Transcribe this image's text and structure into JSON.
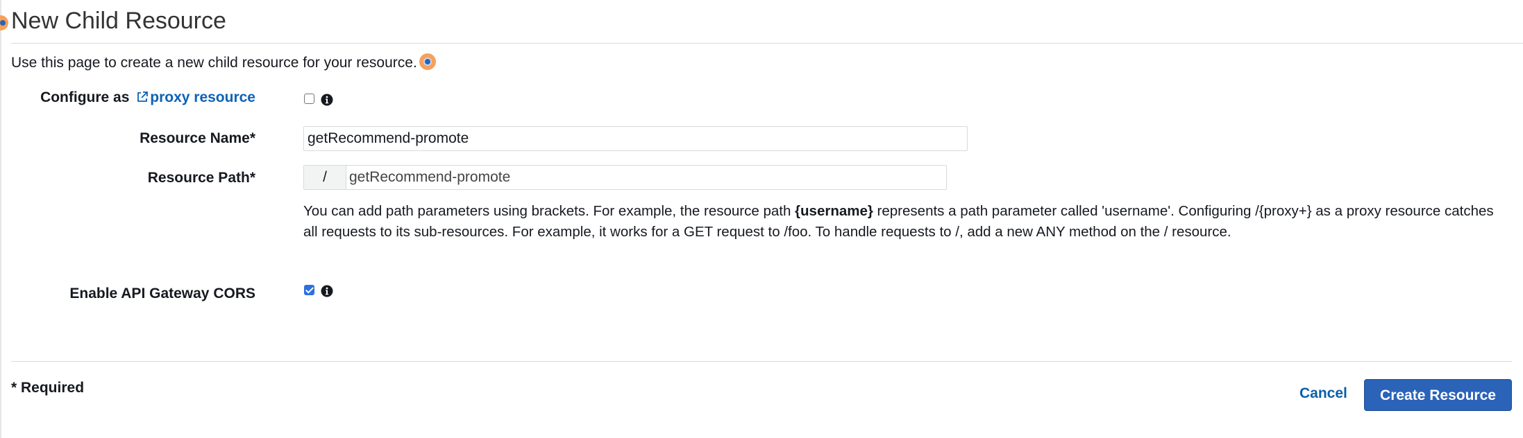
{
  "page": {
    "title": "New Child Resource",
    "description": "Use this page to create a new child resource for your resource."
  },
  "form": {
    "proxy": {
      "label_prefix": "Configure as ",
      "link_text": "proxy resource",
      "checked": false,
      "icon": "info-icon"
    },
    "resource_name": {
      "label": "Resource Name*",
      "value": "getRecommend-promote"
    },
    "resource_path": {
      "label": "Resource Path*",
      "prefix": "/",
      "value": "getRecommend-promote"
    },
    "help": {
      "part1": "You can add path parameters using brackets. For example, the resource path ",
      "bold": "{username}",
      "part2": " represents a path parameter called 'username'. Configuring /{proxy+} as a proxy resource catches all requests to its sub-resources. For example, it works for a GET request to /foo. To handle requests to /, add a new ANY method on the / resource."
    },
    "cors": {
      "label": "Enable API Gateway CORS",
      "checked": true,
      "icon": "info-icon"
    }
  },
  "footer": {
    "required_note": "* Required",
    "cancel_label": "Cancel",
    "create_label": "Create Resource"
  },
  "colors": {
    "primary_button": "#2a63b8",
    "link": "#0b62b8",
    "checkbox_checked": "#2f6fe0",
    "hint_marker": "#f5a15a"
  }
}
